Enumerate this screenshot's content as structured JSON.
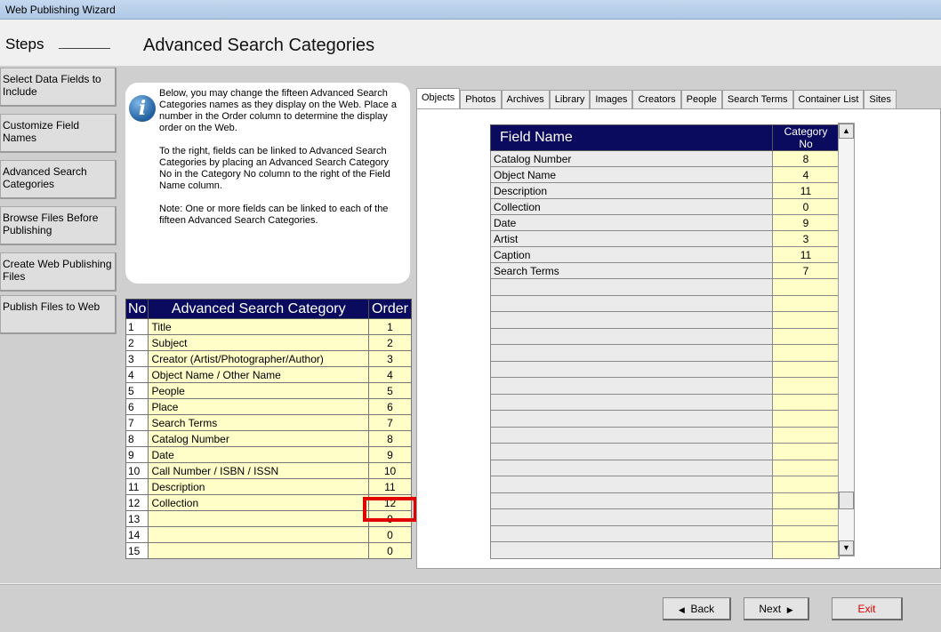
{
  "window": {
    "title": "Web Publishing Wizard"
  },
  "steps": {
    "header": "Steps",
    "items": [
      {
        "label": "Select Data Fields to Include"
      },
      {
        "label": "Customize Field Names"
      },
      {
        "label": "Advanced Search Categories"
      },
      {
        "label": "Browse Files Before Publishing"
      },
      {
        "label": "Create Web Publishing Files"
      },
      {
        "label": "Publish Files to Web"
      }
    ]
  },
  "page": {
    "title": "Advanced Search Categories"
  },
  "info": {
    "p1": "Below, you may change the fifteen Advanced Search Categories names as they display on the Web.   Place a number in the Order column to determine the display order on the Web.",
    "p2": "To the right, fields can be linked to Advanced Search Categories by placing an Advanced Search Category No in the Category No column to the right of the Field Name column.",
    "p3": "Note: One or more fields can be linked to each of the fifteen Advanced Search Categories."
  },
  "categories": {
    "headers": {
      "no": "No",
      "name": "Advanced Search Category",
      "order": "Order"
    },
    "rows": [
      {
        "no": "1",
        "name": "Title",
        "order": "1"
      },
      {
        "no": "2",
        "name": "Subject",
        "order": "2"
      },
      {
        "no": "3",
        "name": "Creator (Artist/Photographer/Author)",
        "order": "3"
      },
      {
        "no": "4",
        "name": "Object Name / Other Name",
        "order": "4"
      },
      {
        "no": "5",
        "name": "People",
        "order": "5"
      },
      {
        "no": "6",
        "name": "Place",
        "order": "6"
      },
      {
        "no": "7",
        "name": "Search Terms",
        "order": "7"
      },
      {
        "no": "8",
        "name": "Catalog Number",
        "order": "8"
      },
      {
        "no": "9",
        "name": "Date",
        "order": "9"
      },
      {
        "no": "10",
        "name": "Call Number / ISBN / ISSN",
        "order": "10"
      },
      {
        "no": "11",
        "name": "Description",
        "order": "11"
      },
      {
        "no": "12",
        "name": "Collection",
        "order": "12"
      },
      {
        "no": "13",
        "name": "",
        "order": "0"
      },
      {
        "no": "14",
        "name": "",
        "order": "0"
      },
      {
        "no": "15",
        "name": "",
        "order": "0"
      }
    ]
  },
  "tabs": [
    "Objects",
    "Photos",
    "Archives",
    "Library",
    "Images",
    "Creators",
    "People",
    "Search Terms",
    "Container List",
    "Sites"
  ],
  "fields": {
    "headers": {
      "name": "Field Name",
      "catno": "Category No"
    },
    "rows": [
      {
        "name": "Catalog Number",
        "catno": "8"
      },
      {
        "name": "Object Name",
        "catno": "4"
      },
      {
        "name": "Description",
        "catno": "11"
      },
      {
        "name": "Collection",
        "catno": "0"
      },
      {
        "name": "Date",
        "catno": "9"
      },
      {
        "name": "Artist",
        "catno": "3"
      },
      {
        "name": "Caption",
        "catno": "11"
      },
      {
        "name": "Search Terms",
        "catno": "7"
      }
    ],
    "empty_rows": 17
  },
  "buttons": {
    "back": "Back",
    "next": "Next",
    "exit": "Exit"
  },
  "colors": {
    "header_navy": "#0a0a5e",
    "cell_yellow": "#fffdc8",
    "highlight": "#e00000",
    "exit_text": "#e00000"
  }
}
